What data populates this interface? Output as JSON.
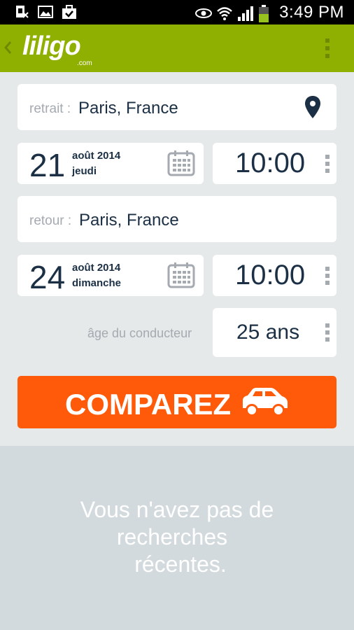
{
  "status_bar": {
    "time": "3:49 PM",
    "icons": [
      "sim-icon",
      "image-icon",
      "briefcase-icon",
      "eye-icon",
      "wifi-icon",
      "signal-icon",
      "battery-icon"
    ]
  },
  "app_bar": {
    "logo_main": "liligo",
    "logo_sub": ".com",
    "accent_color": "#8fb000"
  },
  "pickup": {
    "label": "retrait :",
    "location": "Paris, France",
    "date_day": "21",
    "date_month": "août 2014",
    "date_weekday": "jeudi",
    "time": "10:00"
  },
  "return": {
    "label": "retour :",
    "location": "Paris, France",
    "date_day": "24",
    "date_month": "août 2014",
    "date_weekday": "dimanche",
    "time": "10:00"
  },
  "driver": {
    "label": "âge du conducteur",
    "age": "25 ans"
  },
  "compare": {
    "label": "COMPAREZ",
    "color": "#ff5a0a"
  },
  "recent": {
    "line1": "Vous n'avez pas de",
    "line2": "recherches",
    "line3": "récentes."
  }
}
